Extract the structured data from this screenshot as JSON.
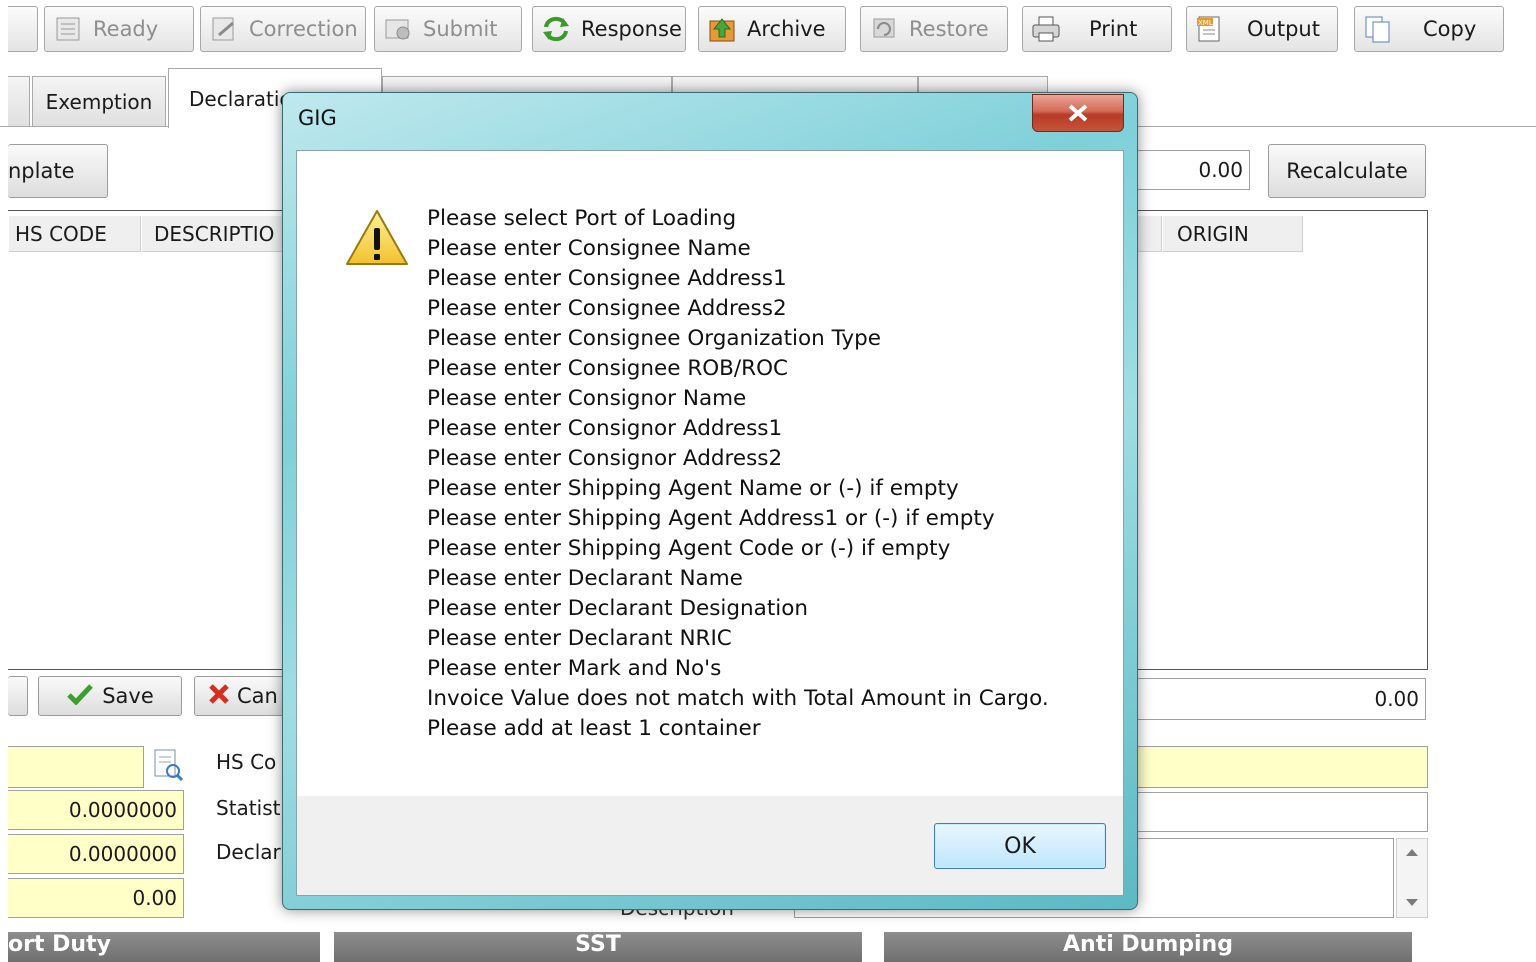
{
  "toolbar": {
    "ready": "Ready",
    "correction": "Correction",
    "submit": "Submit",
    "response": "Response",
    "archive": "Archive",
    "restore": "Restore",
    "print": "Print",
    "output": "Output",
    "copy": "Copy"
  },
  "tabs": {
    "exemption": "Exemption",
    "declaration": "Declaration"
  },
  "form": {
    "template_button": "nplate",
    "total_value": "0.00",
    "recalculate": "Recalculate",
    "save": "Save",
    "cancel": "Can",
    "amount": "0.00",
    "rate1": "0.0000000",
    "rate2": "0.0000000",
    "value3": "0.00",
    "hs_code_label": "HS Co",
    "statistic_label": "Statist",
    "declared_label": "Declar",
    "description_label": "Description"
  },
  "grid": {
    "columns": [
      "HS CODE",
      "DESCRIPTIO",
      "ORIGIN"
    ]
  },
  "bottom_tabs": [
    "ort Duty",
    "SST",
    "Anti Dumping"
  ],
  "dialog": {
    "title": "GIG",
    "close": "x",
    "ok": "OK",
    "messages": [
      "Please select Port of Loading",
      "Please enter Consignee Name",
      "Please enter Consignee Address1",
      "Please enter Consignee Address2",
      "Please enter Consignee Organization Type",
      "Please enter Consignee ROB/ROC",
      "Please enter Consignor Name",
      "Please enter Consignor Address1",
      "Please enter Consignor Address2",
      "Please enter Shipping Agent Name or (-) if empty",
      "Please enter Shipping Agent Address1 or (-) if empty",
      "Please enter Shipping Agent Code or (-) if empty",
      "Please enter Declarant Name",
      "Please enter Declarant Designation",
      "Please enter Declarant NRIC",
      "Please enter Mark and No's",
      "Invoice Value does not match with Total Amount in Cargo.",
      "Please add at least 1 container"
    ]
  }
}
